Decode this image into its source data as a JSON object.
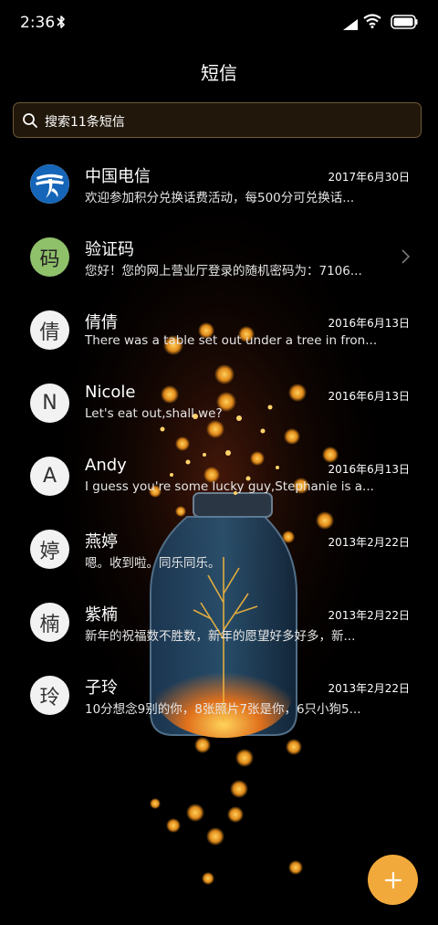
{
  "status_bar": {
    "time": "2:36",
    "icons": [
      "bluetooth-icon",
      "signal-icon",
      "wifi-icon",
      "battery-icon"
    ]
  },
  "header": {
    "title": "短信"
  },
  "search": {
    "text": "搜索11条短信",
    "icon": "search-icon"
  },
  "conversations": [
    {
      "avatar": "",
      "avatar_kind": "china-telecom-logo",
      "name": "中国电信",
      "date": "2017年6月30日",
      "preview": "欢迎参加积分兑换话费活动，每500分可兑换话..."
    },
    {
      "avatar": "码",
      "avatar_kind": "green",
      "name": "验证码",
      "date": "",
      "preview": "您好！您的网上营业厅登录的随机密码为：7106...",
      "has_chevron": true
    },
    {
      "avatar": "倩",
      "avatar_kind": "letter",
      "name": "倩倩",
      "date": "2016年6月13日",
      "preview": "There was a table set out under a tree in fron..."
    },
    {
      "avatar": "N",
      "avatar_kind": "letter",
      "name": "Nicole",
      "date": "2016年6月13日",
      "preview": "Let's eat out,shall we?"
    },
    {
      "avatar": "A",
      "avatar_kind": "letter",
      "name": "Andy",
      "date": "2016年6月13日",
      "preview": "I guess you're some lucky guy,Stephanie is a..."
    },
    {
      "avatar": "婷",
      "avatar_kind": "letter",
      "name": "燕婷",
      "date": "2013年2月22日",
      "preview": "嗯。收到啦。同乐同乐。"
    },
    {
      "avatar": "楠",
      "avatar_kind": "letter",
      "name": "紫楠",
      "date": "2013年2月22日",
      "preview": "新年的祝福数不胜数，新年的愿望好多好多，新..."
    },
    {
      "avatar": "玲",
      "avatar_kind": "letter",
      "name": "子玲",
      "date": "2013年2月22日",
      "preview": "10分想念9别的你，8张照片7张是你，6只小狗5..."
    }
  ],
  "fab": {
    "icon": "plus-icon",
    "label": "+"
  },
  "colors": {
    "background": "#000000",
    "accent": "#f2a93b",
    "verification_avatar": "#8fc06a",
    "search_border": "#6e5a38"
  }
}
